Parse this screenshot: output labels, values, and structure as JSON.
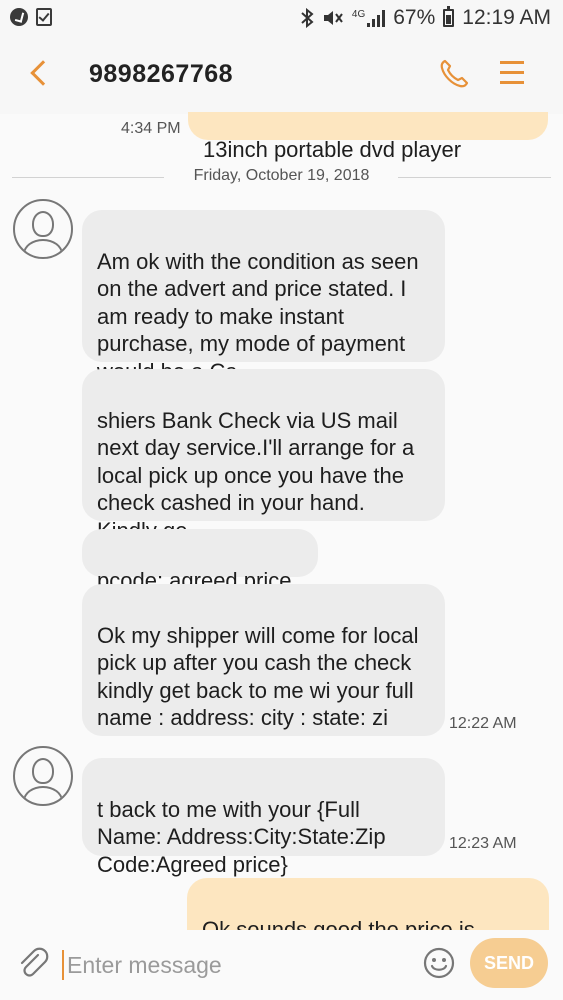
{
  "status_bar": {
    "network": "4G",
    "battery": "67%",
    "time": "12:19 AM"
  },
  "header": {
    "contact": "9898267768"
  },
  "conversation": {
    "previous_message": {
      "text": "13inch portable dvd player",
      "time": "4:34 PM"
    },
    "date_separator": "Friday, October 19, 2018",
    "messages": [
      {
        "text": "Am ok with the condition as seen on the advert and price stated. I am ready to make instant purchase, my mode of payment would be a Ca"
      },
      {
        "text": "shiers Bank Check via US mail next day service.I'll arrange for a local pick up once you have the check cashed in your hand. Kindly ge"
      },
      {
        "text": "pcode: agreed price"
      },
      {
        "text": "Ok my shipper will come for local pick up after you cash the check kindly get back to me wi your full name : address: city : state: zi",
        "time": "12:22 AM"
      },
      {
        "text": "t back to me with your {Full Name: Address:City:State:Zip Code:Agreed price}",
        "time": "12:23 AM"
      }
    ],
    "outgoing_partial": {
      "text": "Ok sounds good the price is"
    }
  },
  "input_bar": {
    "placeholder": "Enter message",
    "send_label": "SEND"
  },
  "colors": {
    "accent": "#e79138",
    "incoming_bubble": "#ececec",
    "outgoing_bubble": "#fde6c0"
  }
}
